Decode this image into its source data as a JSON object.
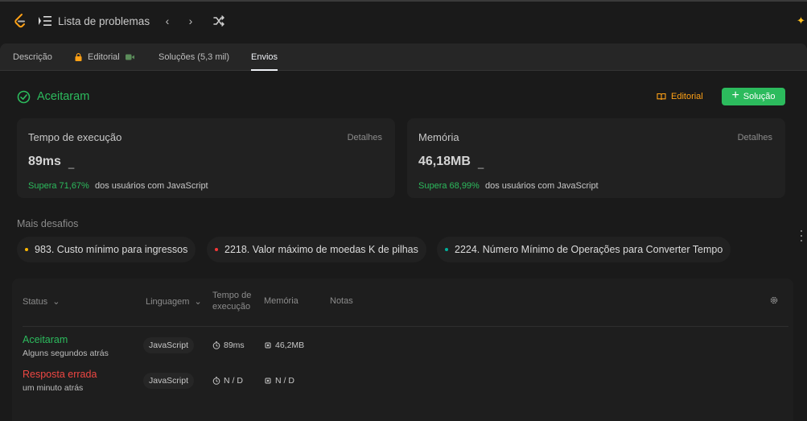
{
  "topbar": {
    "title": "Lista de problemas",
    "icons": {
      "logo": "leetcode-logo",
      "list": "list-icon",
      "prev": "chevron-left-icon",
      "next": "chevron-right-icon",
      "shuffle": "shuffle-icon",
      "sparkle": "sparkle-icon"
    }
  },
  "tabs": [
    {
      "label": "Descrição"
    },
    {
      "label": "Editorial"
    },
    {
      "label": "Soluções (5,3 mil)"
    },
    {
      "label": "Envios"
    }
  ],
  "result": {
    "status": "Aceitaram",
    "editorial_button": "Editorial",
    "solution_button": "Solução"
  },
  "runtime": {
    "title": "Tempo de execução",
    "details": "Detalhes",
    "value": "89ms",
    "cursor": "_",
    "beats_pct": "Supera 71,67%",
    "beats_text": "dos usuários com JavaScript"
  },
  "memory": {
    "title": "Memória",
    "details": "Detalhes",
    "value": "46,18MB",
    "cursor": "_",
    "beats_pct": "Supera 68,99%",
    "beats_text": "dos usuários com JavaScript"
  },
  "more_challenges": {
    "label": "Mais desafios",
    "items": [
      {
        "text": "983. Custo mínimo para ingressos",
        "color": "#ffb800"
      },
      {
        "text": "2218. Valor máximo de moedas K de pilhas",
        "color": "#f63737"
      },
      {
        "text": "2224. Número Mínimo de Operações para Converter Tempo",
        "color": "#00af9b"
      }
    ]
  },
  "table": {
    "headers": {
      "status": "Status",
      "language": "Linguagem",
      "runtime_1": "Tempo de",
      "runtime_2": "execução",
      "memory": "Memória",
      "notes": "Notas"
    },
    "rows": [
      {
        "status": "Aceitaram",
        "status_color": "#2cbb5d",
        "time": "Alguns segundos atrás",
        "language": "JavaScript",
        "runtime": "89ms",
        "memory": "46,2MB"
      },
      {
        "status": "Resposta errada",
        "status_color": "#ef4743",
        "time": "um minuto atrás",
        "language": "JavaScript",
        "runtime": "N / D",
        "memory": "N / D"
      }
    ]
  },
  "colors": {
    "accepted": "#2cbb5d",
    "wrong": "#ef4743",
    "editorial": "#ffa116"
  }
}
